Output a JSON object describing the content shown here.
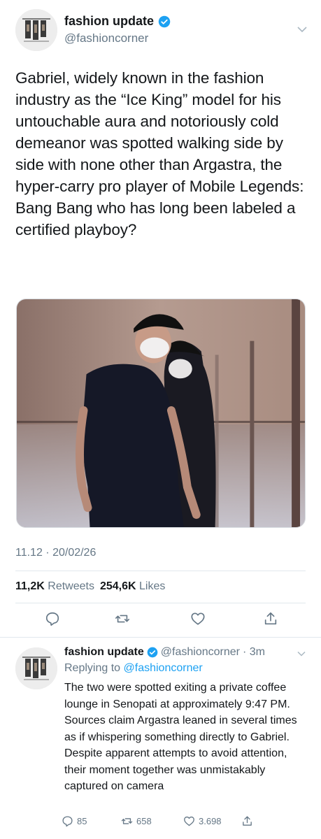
{
  "tweet": {
    "name": "fashion update",
    "handle": "@fashioncorner",
    "text": "Gabriel, widely known in the fashion industry as the “Ice King” model for his untouchable aura and notoriously cold demeanor was spotted walking side by side with none other than Argastra, the hyper-carry pro player of Mobile Legends: Bang Bang who has long been labeled a certified playboy?",
    "timestamp": "11.12 · 20/02/26",
    "retweets_count": "11,2K",
    "retweets_label": "Retweets",
    "likes_count": "254,6K",
    "likes_label": "Likes"
  },
  "reply": {
    "name": "fashion update",
    "handle": "@fashioncorner",
    "age": "· 3m",
    "replying_label": "Replying to",
    "replying_to": "@fashioncorner",
    "text": "The two were spotted exiting a private coffee lounge in Senopati at approximately 9:47 PM. Sources claim Argastra leaned in several times as if whispering something directly to Gabriel. Despite apparent attempts to avoid attention, their moment together was unmistakably captured on camera",
    "replies": "85",
    "retweets": "658",
    "likes": "3.698"
  },
  "colors": {
    "accent": "#1da1f2",
    "secondary_text": "#657786"
  },
  "icons": [
    "verified-badge-icon",
    "chevron-down-icon",
    "reply-icon",
    "retweet-icon",
    "like-icon",
    "share-icon"
  ]
}
